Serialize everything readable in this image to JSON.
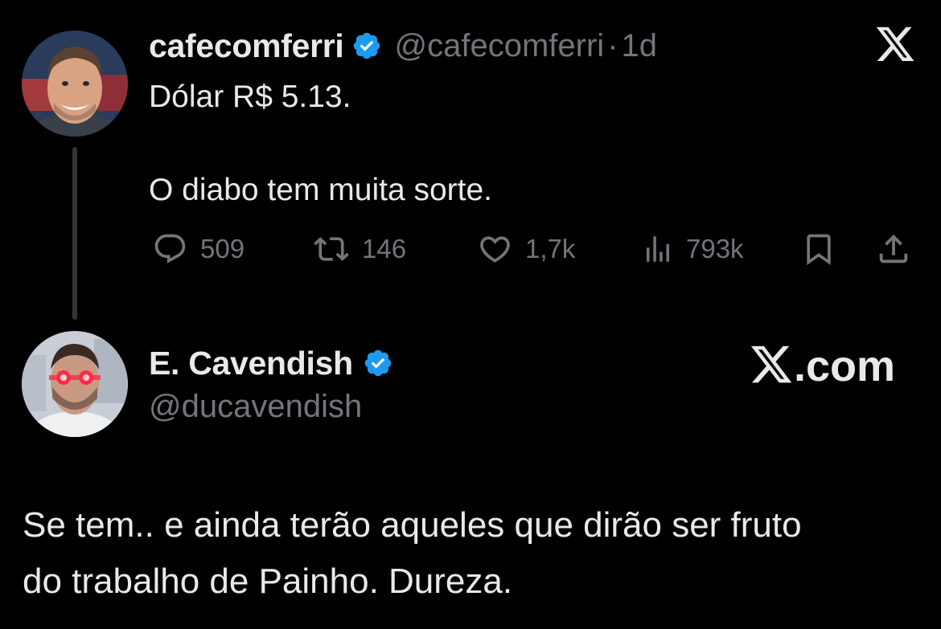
{
  "original_tweet": {
    "display_name": "cafecomferri",
    "handle": "@cafecomferri",
    "separator": "·",
    "time": "1d",
    "line1": "Dólar R$ 5.13.",
    "line2": "O diabo tem muita sorte.",
    "verified_color": "#1d9bf0",
    "metrics": {
      "replies": "509",
      "reposts": "146",
      "likes": "1,7k",
      "views": "793k"
    }
  },
  "reply_tweet": {
    "display_name": "E. Cavendish",
    "handle": "@ducavendish",
    "watermark_suffix": ".com",
    "line1": "Se tem.. e ainda terão aqueles que dirão ser fruto",
    "line2": "do trabalho de Painho. Dureza."
  },
  "icons": {
    "top_right": "x-logo-icon",
    "reply": "reply-bubble-icon",
    "repost": "repost-icon",
    "like": "heart-icon",
    "views": "views-bar-icon",
    "bookmark": "bookmark-icon",
    "share": "share-icon"
  },
  "colors": {
    "background": "#000000",
    "text_primary": "#e7e9ea",
    "text_secondary": "#71767b",
    "thread_line": "#333639"
  }
}
